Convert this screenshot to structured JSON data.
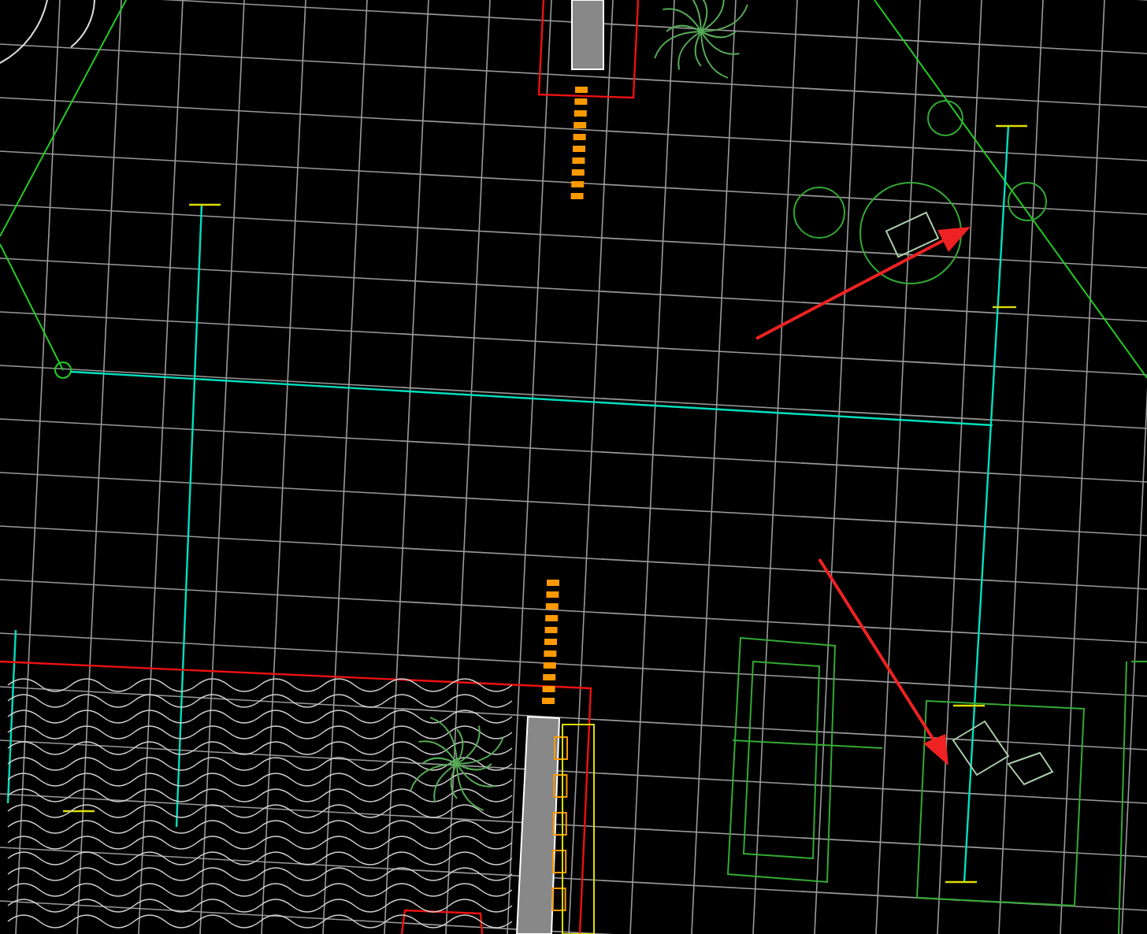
{
  "viewport": {
    "kind": "cad-drawing"
  }
}
